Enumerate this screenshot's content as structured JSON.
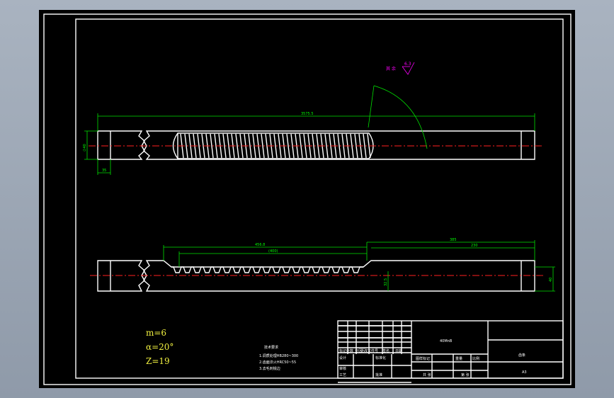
{
  "colors": {
    "background": "#9aa4b2",
    "sheet": "#000000",
    "outline": "#ffffff",
    "dimension": "#00e000",
    "centerline": "#ff2020",
    "annotation": "#ff00ff",
    "param_text": "#f0f040"
  },
  "dimensions": {
    "top_overall": "3575.5",
    "top_height": "∅40",
    "top_end_small": "35",
    "bottom_thread_total": "456.8",
    "bottom_thread_inner": "(400)",
    "bottom_right_total": "385",
    "bottom_right_inner": "230",
    "bottom_right_height": "40",
    "bottom_depth": "32.5"
  },
  "surface_symbol": {
    "label": "其 余",
    "roughness": "6.3"
  },
  "gear_params": {
    "module": "m=6",
    "pressure_angle": "α=20°",
    "teeth": "Z=19"
  },
  "tech_requirements": {
    "title": "技术要求",
    "lines": [
      "1.调质处理HB280~300",
      "2.齿面淬火HRC50~55",
      "3.去毛刺锐边"
    ]
  },
  "title_block": {
    "material": "40MnB",
    "part_name": "齿条",
    "sheet_size": "A3",
    "row_labels": [
      "标记处数",
      "分区",
      "更改文件号",
      "签名",
      "日期"
    ],
    "roles": [
      "设计",
      "标准化",
      "审核",
      "工艺",
      "批准"
    ],
    "stage_headers": [
      "图样标记",
      "重量",
      "比例"
    ],
    "sheet_labels": [
      "共 张",
      "第 张"
    ]
  }
}
